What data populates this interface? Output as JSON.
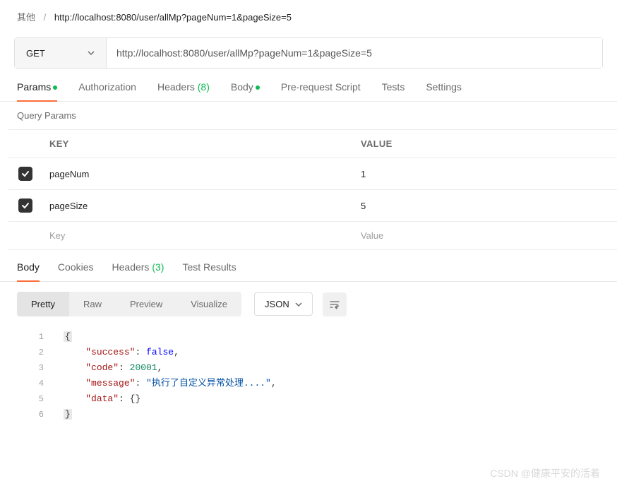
{
  "breadcrumb": {
    "root": "其他",
    "title": "http://localhost:8080/user/allMp?pageNum=1&pageSize=5"
  },
  "request": {
    "method": "GET",
    "url": "http://localhost:8080/user/allMp?pageNum=1&pageSize=5"
  },
  "tabs": {
    "params": "Params",
    "auth": "Authorization",
    "headers_label": "Headers",
    "headers_count": "(8)",
    "body": "Body",
    "prerequest": "Pre-request Script",
    "tests": "Tests",
    "settings": "Settings"
  },
  "query_params": {
    "section_label": "Query Params",
    "header_key": "KEY",
    "header_value": "VALUE",
    "rows": [
      {
        "key": "pageNum",
        "value": "1",
        "enabled": true
      },
      {
        "key": "pageSize",
        "value": "5",
        "enabled": true
      }
    ],
    "placeholder_key": "Key",
    "placeholder_value": "Value"
  },
  "response_tabs": {
    "body": "Body",
    "cookies": "Cookies",
    "headers_label": "Headers",
    "headers_count": "(3)",
    "test_results": "Test Results"
  },
  "body_views": {
    "pretty": "Pretty",
    "raw": "Raw",
    "preview": "Preview",
    "visualize": "Visualize",
    "format": "JSON"
  },
  "response_json": {
    "lines": [
      {
        "n": "1",
        "indent": 0,
        "tokens": [
          {
            "t": "{",
            "c": "brace bracebox"
          }
        ]
      },
      {
        "n": "2",
        "indent": 1,
        "tokens": [
          {
            "t": "\"success\"",
            "c": "key"
          },
          {
            "t": ": ",
            "c": "punc"
          },
          {
            "t": "false",
            "c": "bool"
          },
          {
            "t": ",",
            "c": "punc"
          }
        ]
      },
      {
        "n": "3",
        "indent": 1,
        "tokens": [
          {
            "t": "\"code\"",
            "c": "key"
          },
          {
            "t": ": ",
            "c": "punc"
          },
          {
            "t": "20001",
            "c": "num"
          },
          {
            "t": ",",
            "c": "punc"
          }
        ]
      },
      {
        "n": "4",
        "indent": 1,
        "tokens": [
          {
            "t": "\"message\"",
            "c": "key"
          },
          {
            "t": ": ",
            "c": "punc"
          },
          {
            "t": "\"执行了自定义异常处理....\"",
            "c": "str"
          },
          {
            "t": ",",
            "c": "punc"
          }
        ]
      },
      {
        "n": "5",
        "indent": 1,
        "tokens": [
          {
            "t": "\"data\"",
            "c": "key"
          },
          {
            "t": ": ",
            "c": "punc"
          },
          {
            "t": "{}",
            "c": "brace"
          }
        ]
      },
      {
        "n": "6",
        "indent": 0,
        "tokens": [
          {
            "t": "}",
            "c": "brace bracebox"
          }
        ]
      }
    ]
  },
  "watermark": "CSDN @健康平安的活着"
}
